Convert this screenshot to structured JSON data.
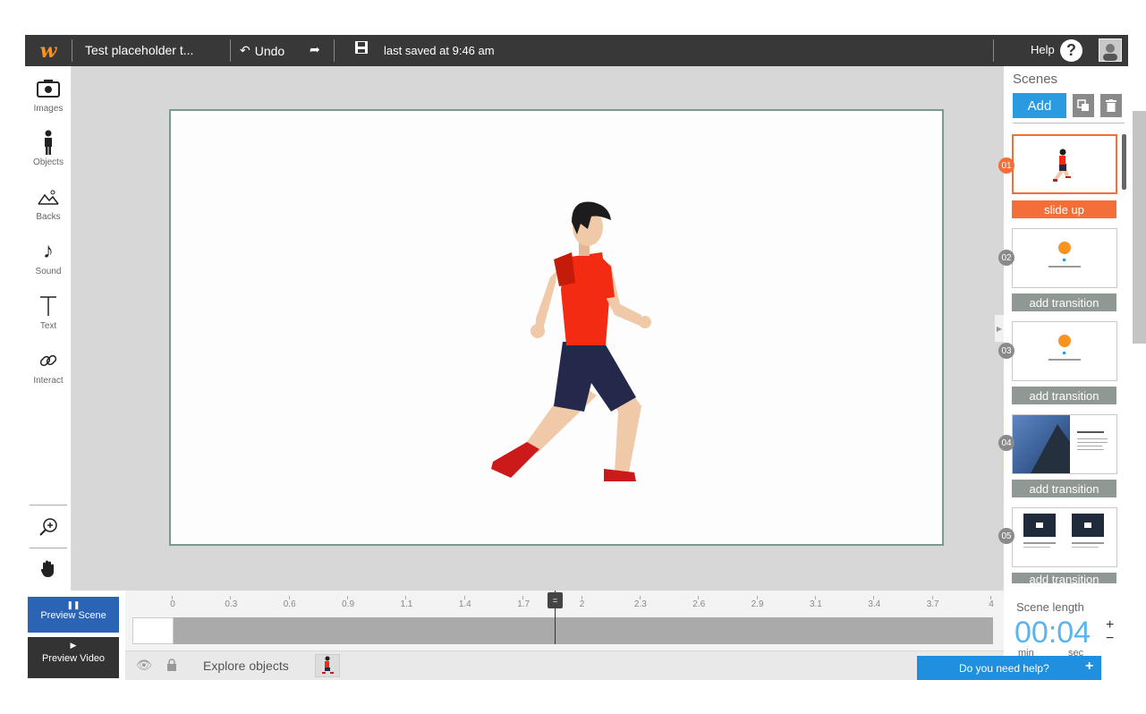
{
  "header": {
    "logo": "w",
    "project_title": "Test placeholder t...",
    "undo_label": "Undo",
    "saved_text": "last saved at 9:46 am",
    "help_label": "Help",
    "help_icon": "?"
  },
  "left_tools": {
    "images": "Images",
    "objects": "Objects",
    "backs": "Backs",
    "sound": "Sound",
    "text": "Text",
    "interact": "Interact"
  },
  "scenes_panel": {
    "title": "Scenes",
    "add_label": "Add",
    "scenes": [
      {
        "num": "01",
        "transition": "slide up",
        "active": true
      },
      {
        "num": "02",
        "transition": "add transition",
        "active": false
      },
      {
        "num": "03",
        "transition": "add transition",
        "active": false
      },
      {
        "num": "04",
        "transition": "add transition",
        "active": false
      },
      {
        "num": "05",
        "transition": "add transition",
        "active": false
      }
    ]
  },
  "preview": {
    "scene_label": "Preview Scene",
    "video_label": "Preview Video"
  },
  "timeline": {
    "ticks": [
      "0",
      "0.3",
      "0.6",
      "0.9",
      "1.1",
      "1.4",
      "1.7",
      "2",
      "2.3",
      "2.6",
      "2.9",
      "3.1",
      "3.4",
      "3.7",
      "4"
    ],
    "playhead_value": 1.9
  },
  "bottom": {
    "explore_label": "Explore objects"
  },
  "scene_length": {
    "label": "Scene length",
    "time": "00:04",
    "min_label": "min",
    "sec_label": "sec",
    "plus": "+",
    "minus": "−"
  },
  "help_chat": {
    "label": "Do you need help?",
    "plus": "+"
  },
  "colors": {
    "accent_blue": "#2a9be0",
    "accent_orange": "#f36f37",
    "topbar": "#383838"
  }
}
